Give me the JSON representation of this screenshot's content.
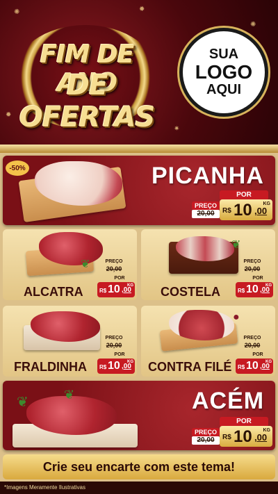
{
  "header": {
    "title_line1": "FIM DE ANO",
    "title_line2": "DE OFERTAS",
    "logo_line1": "SUA",
    "logo_line2": "LOGO",
    "logo_line3": "AQUI"
  },
  "products": {
    "picanha": {
      "name": "PICANHA",
      "badge": "-50%",
      "preco_label": "PREÇO",
      "old_price": "20,00",
      "por_label": "POR",
      "currency": "R$",
      "price_int": "10",
      "price_cents": ",00",
      "unit": "KG"
    },
    "alcatra": {
      "name": "ALCATRA",
      "preco_label": "PREÇO",
      "old_price": "20,00",
      "por_label": "POR",
      "currency": "R$",
      "price_int": "10",
      "price_cents": ",00",
      "unit": "KG"
    },
    "costela": {
      "name": "COSTELA",
      "preco_label": "PREÇO",
      "old_price": "20,00",
      "por_label": "POR",
      "currency": "R$",
      "price_int": "10",
      "price_cents": ",00",
      "unit": "KG"
    },
    "fraldinha": {
      "name": "FRALDINHA",
      "preco_label": "PREÇO",
      "old_price": "20,00",
      "por_label": "POR",
      "currency": "R$",
      "price_int": "10",
      "price_cents": ",00",
      "unit": "KG"
    },
    "contra_file": {
      "name": "CONTRA FILÉ",
      "preco_label": "PREÇO",
      "old_price": "20,00",
      "por_label": "POR",
      "currency": "R$",
      "price_int": "10",
      "price_cents": ",00",
      "unit": "KG"
    },
    "acem": {
      "name": "ACÉM",
      "preco_label": "PREÇO",
      "old_price": "20,00",
      "por_label": "POR",
      "currency": "R$",
      "price_int": "10",
      "price_cents": ",00",
      "unit": "KG"
    }
  },
  "cta": {
    "text": "Crie seu encarte com este tema!"
  },
  "footer": {
    "note": "*Imagens Meramente Ilustrativas"
  },
  "colors": {
    "brand_red": "#7a1016",
    "gold": "#d9ac3f",
    "price_red": "#c71a22",
    "card_beige": "#f0dca8"
  }
}
